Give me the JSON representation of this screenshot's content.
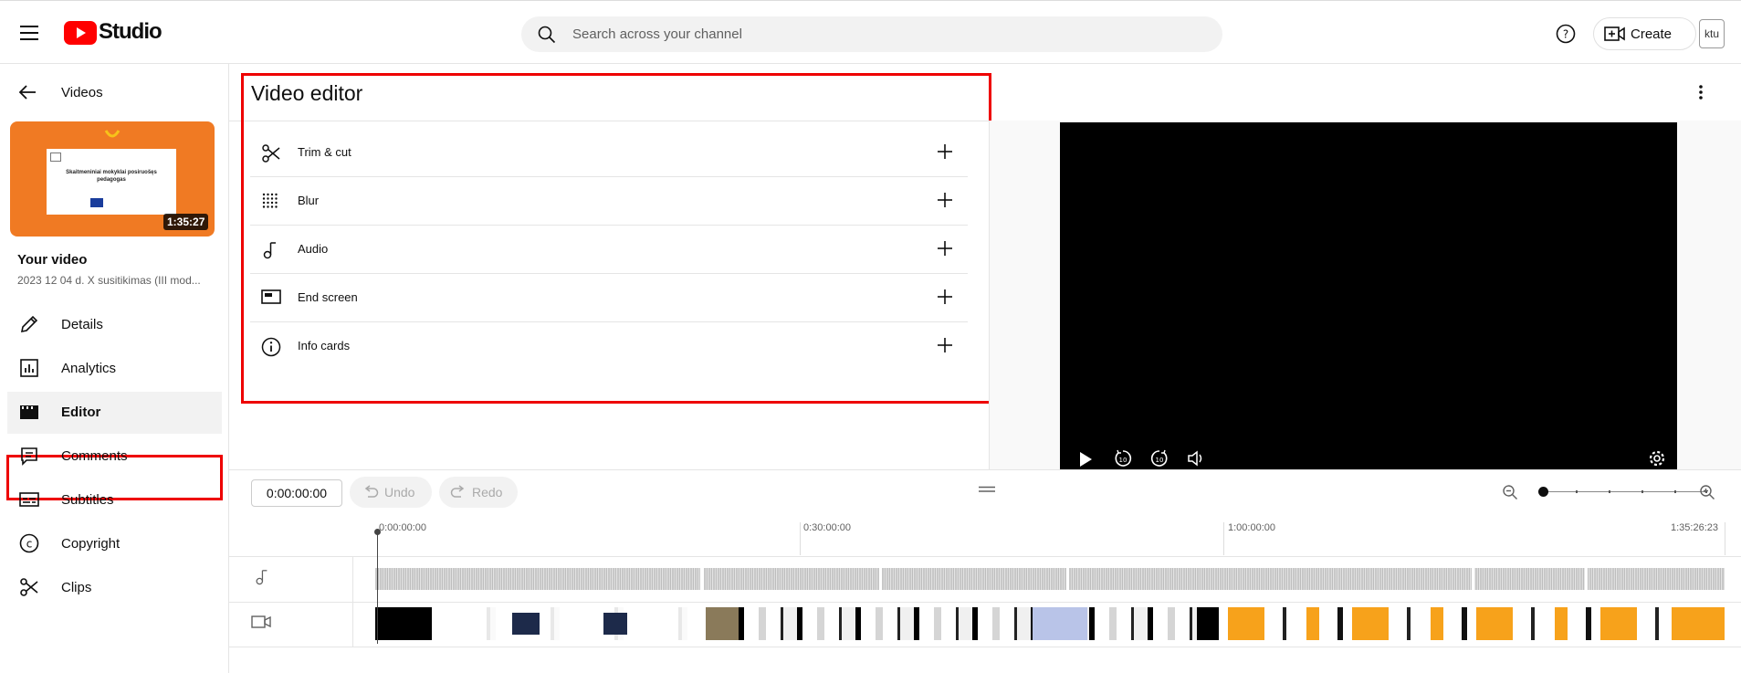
{
  "header": {
    "logo_text": "Studio",
    "search_placeholder": "Search across your channel",
    "create_label": "Create",
    "avatar_text": "ktu"
  },
  "sidebar": {
    "back_label": "Videos",
    "thumbnail": {
      "duration": "1:35:27",
      "title_line1": "Skaitmeniniai mokyklai posiruošęs",
      "title_line2": "pedagogas"
    },
    "your_video_label": "Your video",
    "video_title": "2023 12 04 d. X susitikimas (III mod...",
    "items": [
      {
        "label": "Details",
        "icon": "pencil-icon"
      },
      {
        "label": "Analytics",
        "icon": "analytics-icon"
      },
      {
        "label": "Editor",
        "icon": "clapper-icon"
      },
      {
        "label": "Comments",
        "icon": "comments-icon"
      },
      {
        "label": "Subtitles",
        "icon": "subtitles-icon"
      },
      {
        "label": "Copyright",
        "icon": "copyright-icon"
      },
      {
        "label": "Clips",
        "icon": "scissors-icon"
      }
    ]
  },
  "editor": {
    "title": "Video editor",
    "tools": [
      {
        "label": "Trim & cut",
        "icon": "scissors-icon"
      },
      {
        "label": "Blur",
        "icon": "blur-icon"
      },
      {
        "label": "Audio",
        "icon": "music-note-icon"
      },
      {
        "label": "End screen",
        "icon": "end-screen-icon"
      },
      {
        "label": "Info cards",
        "icon": "info-icon"
      }
    ]
  },
  "timeline": {
    "timecode": "0:00:00:00",
    "undo_label": "Undo",
    "redo_label": "Redo",
    "ticks": [
      "0:00:00:00",
      "0:30:00:00",
      "1:00:00:00",
      "1:35:26:23"
    ]
  },
  "colors": {
    "accent_red": "#ee0000",
    "youtube_red": "#ff0000",
    "thumb_orange": "#f07a23"
  }
}
